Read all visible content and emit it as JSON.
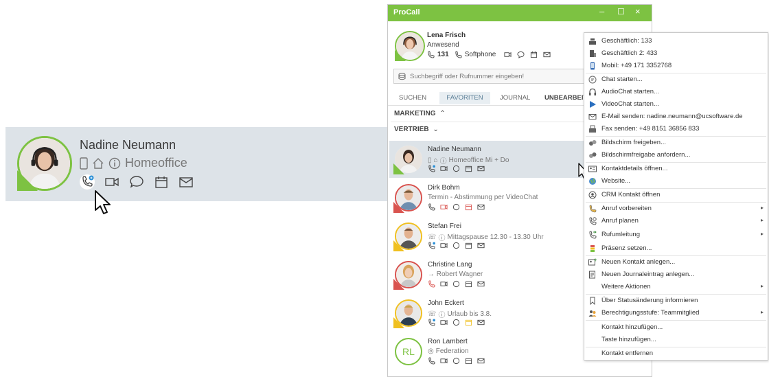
{
  "zoom": {
    "name": "Nadine Neumann",
    "status": "Homeoffice"
  },
  "window": {
    "title": "ProCall",
    "controls": {
      "minimize": "–",
      "maximize": "☐",
      "close": "×"
    }
  },
  "me": {
    "name": "Lena Frisch",
    "status": "Anwesend",
    "extension": "131",
    "device": "Softphone"
  },
  "search": {
    "placeholder": "Suchbegriff oder Rufnummer eingeben!"
  },
  "tabs": [
    "SUCHEN",
    "FAVORITEN",
    "JOURNAL",
    "UNBEARBEIT"
  ],
  "groups": {
    "marketing": "MARKETING",
    "vertrieb": "VERTRIEB"
  },
  "contacts": [
    {
      "name": "Nadine Neumann",
      "status": "Homeoffice Mi + Do",
      "presence": "#7dc242"
    },
    {
      "name": "Dirk Bohm",
      "status": "Termin - Abstimmung per VideoChat",
      "presence": "#d9534f"
    },
    {
      "name": "Stefan Frei",
      "status": "Mittagspause 12.30 - 13.30 Uhr",
      "presence": "#f0c020"
    },
    {
      "name": "Christine Lang",
      "status": "→ Robert Wagner",
      "presence": "#d9534f"
    },
    {
      "name": "John Eckert",
      "status": "Urlaub bis 3.8.",
      "presence": "#f0c020"
    },
    {
      "name": "Ron Lambert",
      "status": "Federation",
      "initials": "RL",
      "presence": "#7dc242"
    }
  ],
  "menu": {
    "items": [
      {
        "label": "Geschäftlich: 133",
        "icon": "desk-phone-icon"
      },
      {
        "label": "Geschäftlich 2: 433",
        "icon": "building-icon"
      },
      {
        "label": "Mobil: +49 171 3352768",
        "icon": "mobile-icon"
      },
      {
        "label": "Chat starten...",
        "icon": "chat-icon"
      },
      {
        "label": "AudioChat starten...",
        "icon": "headset-icon"
      },
      {
        "label": "VideoChat starten...",
        "icon": "play-icon"
      },
      {
        "label": "E-Mail senden: nadine.neumann@ucsoftware.de",
        "icon": "mail-icon"
      },
      {
        "label": "Fax senden: +49 8151 36856 833",
        "icon": "fax-icon"
      },
      {
        "label": "Bildschirm freigeben...",
        "icon": "share-screen-icon"
      },
      {
        "label": "Bildschirmfreigabe anfordern...",
        "icon": "request-screen-icon"
      },
      {
        "label": "Kontaktdetails öffnen...",
        "icon": "contact-card-icon"
      },
      {
        "label": "Website...",
        "icon": "globe-icon"
      },
      {
        "label": "CRM Kontakt öffnen",
        "icon": "crm-icon"
      },
      {
        "label": "Anruf vorbereiten",
        "icon": "prepare-call-icon"
      },
      {
        "label": "Anruf planen",
        "icon": "schedule-call-icon"
      },
      {
        "label": "Rufumleitung",
        "icon": "forward-icon"
      },
      {
        "label": "Präsenz setzen...",
        "icon": "presence-icon"
      },
      {
        "label": "Neuen Kontakt anlegen...",
        "icon": "new-contact-icon"
      },
      {
        "label": "Neuen Journaleintrag anlegen...",
        "icon": "journal-icon"
      },
      {
        "label": "Weitere Aktionen",
        "icon": ""
      },
      {
        "label": "Über Statusänderung informieren",
        "icon": "bookmark-icon"
      },
      {
        "label": "Berechtigungsstufe: Teammitglied",
        "icon": "team-icon"
      },
      {
        "label": "Kontakt hinzufügen...",
        "icon": ""
      },
      {
        "label": "Taste hinzufügen...",
        "icon": ""
      },
      {
        "label": "Kontakt entfernen",
        "icon": ""
      }
    ],
    "submenu_arrow": "▸"
  }
}
